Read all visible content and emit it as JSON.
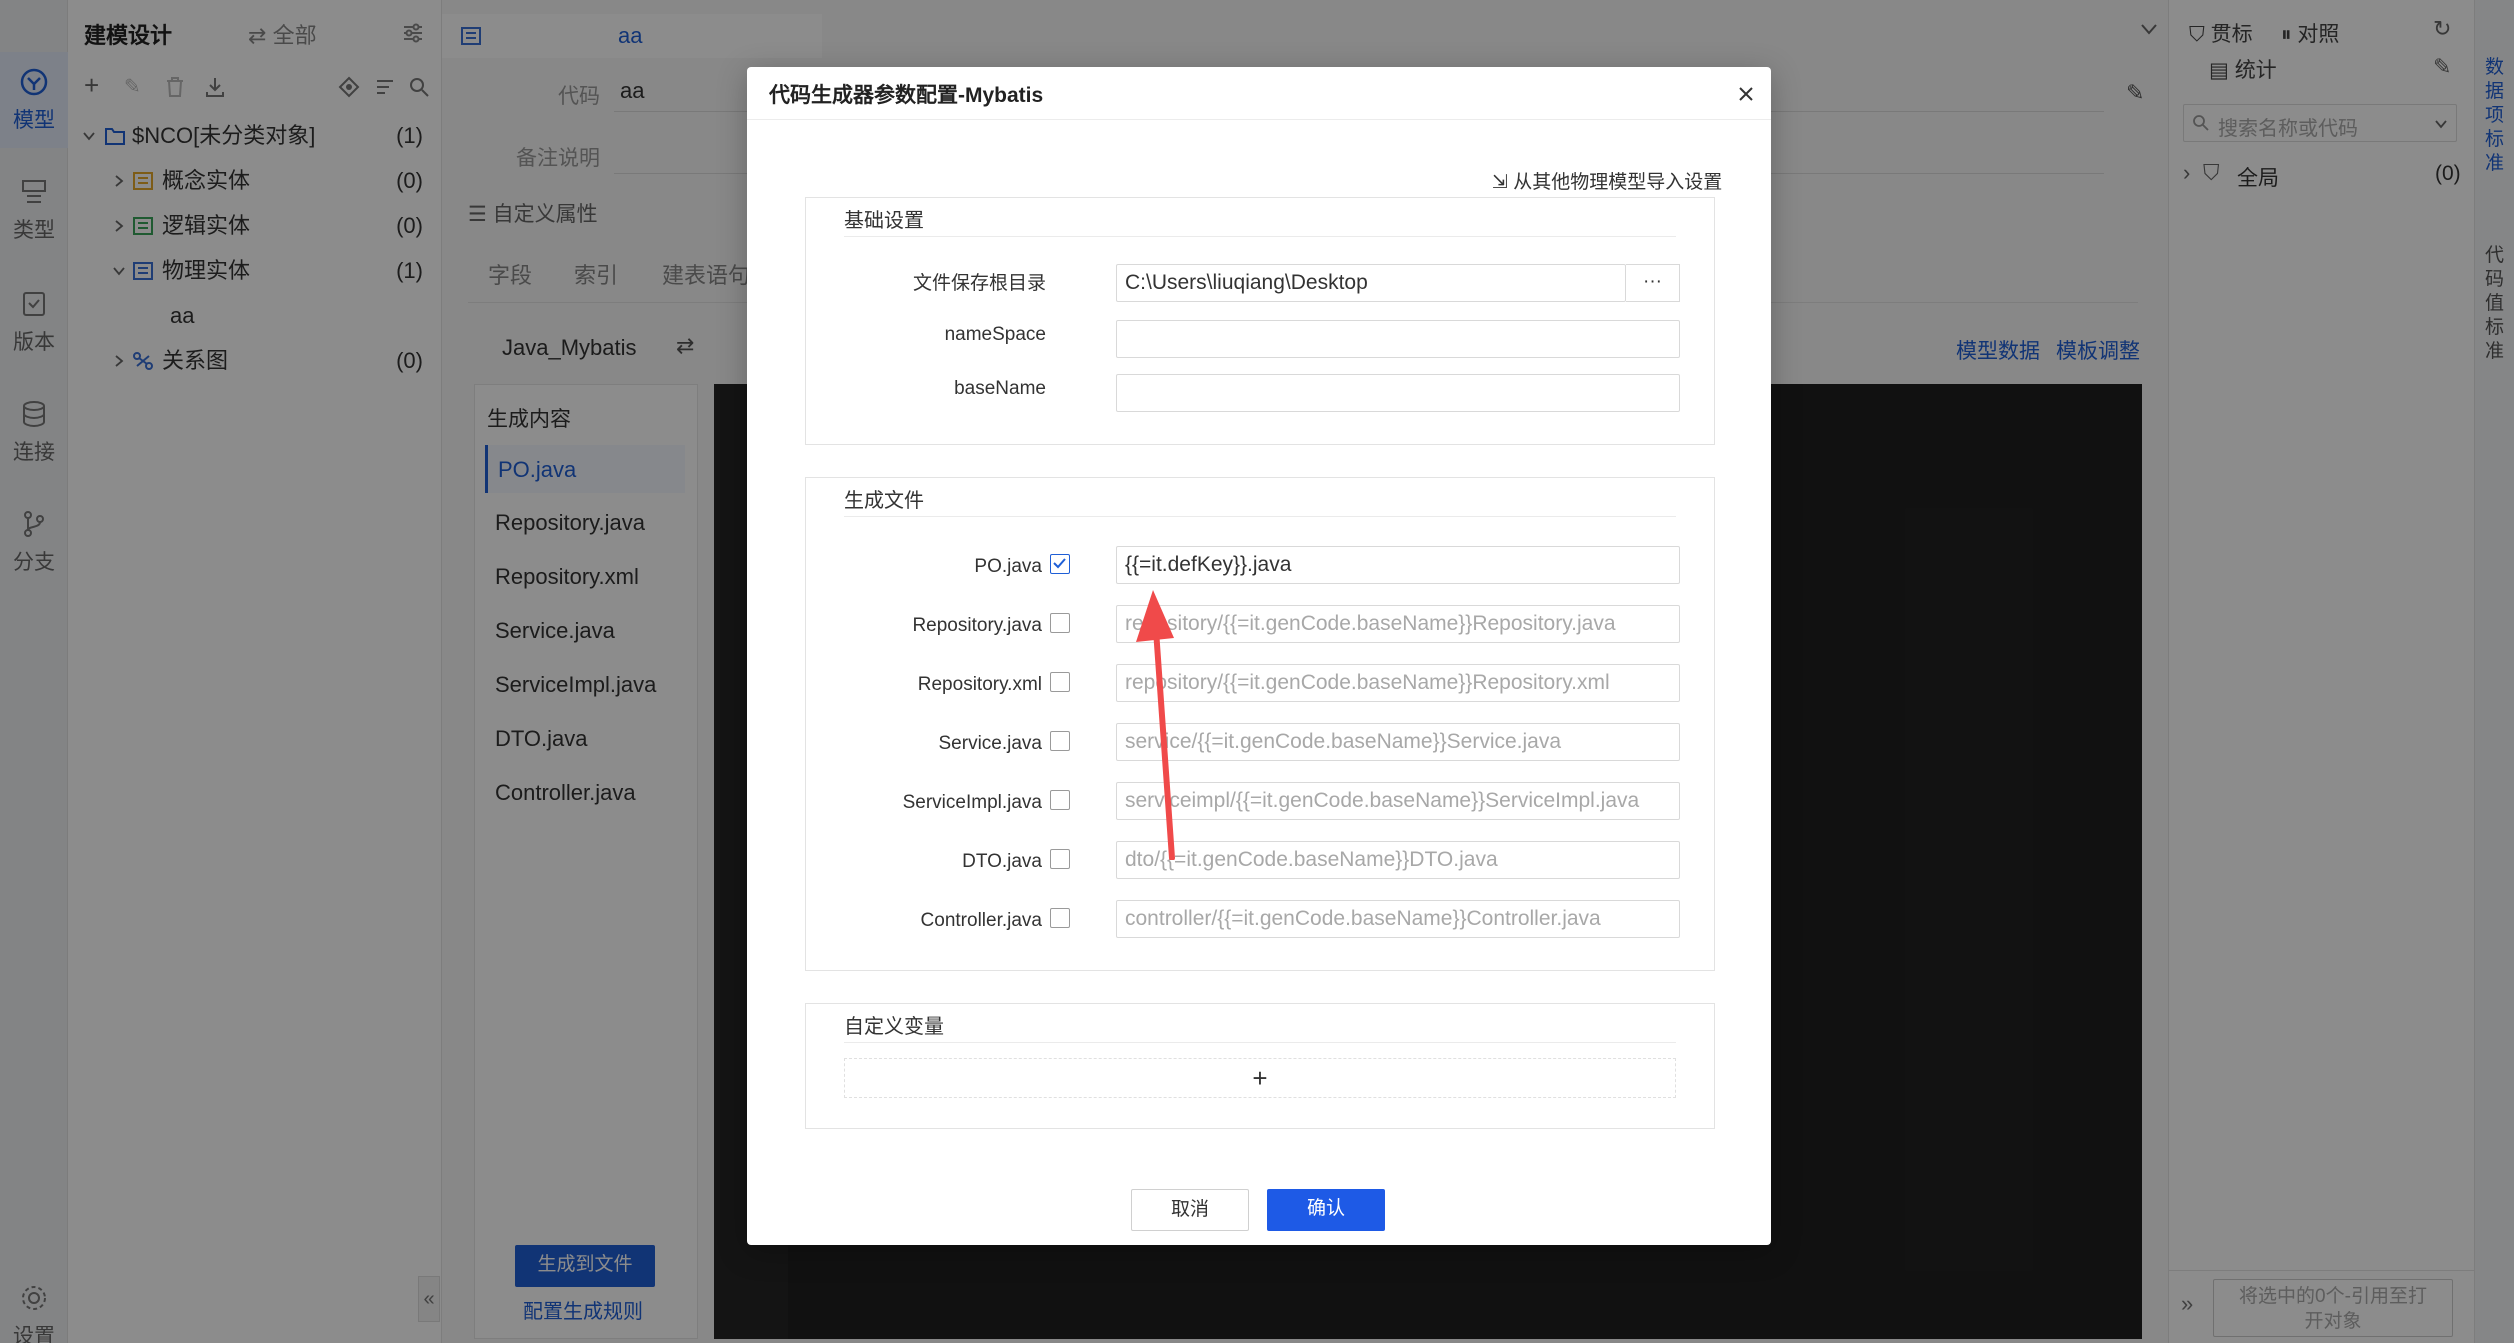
{
  "rail": {
    "items": [
      {
        "label": "模型",
        "icon": "model-icon",
        "active": true
      },
      {
        "label": "类型",
        "icon": "type-icon"
      },
      {
        "label": "版本",
        "icon": "version-icon"
      },
      {
        "label": "连接",
        "icon": "database-icon"
      },
      {
        "label": "分支",
        "icon": "branch-icon"
      }
    ],
    "settings": "设置"
  },
  "tree": {
    "title": "建模设计",
    "filter": "全部",
    "root": {
      "label": "$NCO[未分类对象]",
      "count": "(1)"
    },
    "items": [
      {
        "label": "概念实体",
        "count": "(0)",
        "icon": "concept-entity-icon"
      },
      {
        "label": "逻辑实体",
        "count": "(0)",
        "icon": "logic-entity-icon"
      },
      {
        "label": "物理实体",
        "count": "(1)",
        "icon": "physical-entity-icon"
      },
      {
        "label": "aa",
        "count": ""
      },
      {
        "label": "关系图",
        "count": "(0)",
        "icon": "relation-diagram-icon"
      }
    ]
  },
  "editor": {
    "tab": "aa",
    "code_label": "代码",
    "code_value": "aa",
    "remark_label": "备注说明",
    "custom_props": "自定义属性",
    "tabs": [
      "字段",
      "索引",
      "建表语句"
    ],
    "generator": "Java_Mybatis",
    "content_title": "生成内容",
    "files": [
      "PO.java",
      "Repository.java",
      "Repository.xml",
      "Service.java",
      "ServiceImpl.java",
      "DTO.java",
      "Controller.java"
    ],
    "links": [
      "模型数据",
      "模板调整"
    ],
    "gen_button": "生成到文件",
    "config_link": "配置生成规则"
  },
  "right_panel": {
    "tabs": [
      "贯标",
      "对照"
    ],
    "stats": "统计",
    "search_placeholder": "搜索名称或代码",
    "global_label": "全局",
    "global_count": "(0)",
    "footer_button": "将选中的0个-引用至打开对象"
  },
  "right_strip": {
    "item1": "数据项标准",
    "item2": "代码值标准"
  },
  "modal": {
    "title": "代码生成器参数配置-Mybatis",
    "import_link": "从其他物理模型导入设置",
    "basic_section": "基础设置",
    "save_dir_label": "文件保存根目录",
    "save_dir_value": "C:\\Users\\liuqiang\\Desktop",
    "browse_label": "···",
    "namespace_label": "nameSpace",
    "namespace_value": "",
    "basename_label": "baseName",
    "basename_value": "",
    "files_section": "生成文件",
    "files": [
      {
        "label": "PO.java",
        "checked": true,
        "value": "{{=it.defKey}}.java"
      },
      {
        "label": "Repository.java",
        "checked": false,
        "value": "repository/{{=it.genCode.baseName}}Repository.java"
      },
      {
        "label": "Repository.xml",
        "checked": false,
        "value": "repository/{{=it.genCode.baseName}}Repository.xml"
      },
      {
        "label": "Service.java",
        "checked": false,
        "value": "service/{{=it.genCode.baseName}}Service.java"
      },
      {
        "label": "ServiceImpl.java",
        "checked": false,
        "value": "serviceimpl/{{=it.genCode.baseName}}ServiceImpl.java"
      },
      {
        "label": "DTO.java",
        "checked": false,
        "value": "dto/{{=it.genCode.baseName}}DTO.java"
      },
      {
        "label": "Controller.java",
        "checked": false,
        "value": "controller/{{=it.genCode.baseName}}Controller.java"
      }
    ],
    "custom_section": "自定义变量",
    "add_label": "+",
    "cancel": "取消",
    "confirm": "确认"
  },
  "colors": {
    "accent": "#1f5fd6",
    "primary_button": "#1e5ae6",
    "annotation_arrow": "#f04a4a",
    "editor_dark": "#202020"
  }
}
